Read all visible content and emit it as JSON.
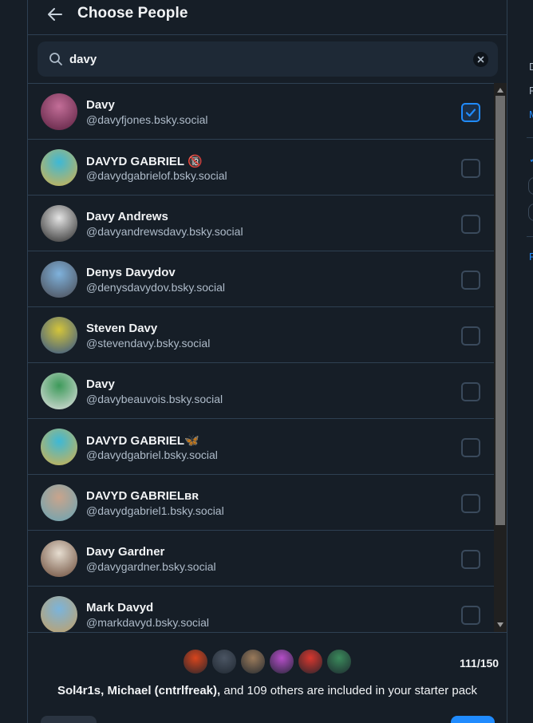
{
  "header": {
    "title": "Choose People"
  },
  "search": {
    "value": "davy"
  },
  "people": [
    {
      "name": "Davy",
      "handle": "@davyfjones.bsky.social",
      "checked": true,
      "avatar_colors": [
        "#c36e98",
        "#5a2040"
      ]
    },
    {
      "name": "DAVYD GABRIEL 🔞",
      "handle": "@davydgabrielof.bsky.social",
      "checked": false,
      "avatar_colors": [
        "#3db8d6",
        "#d6b24a"
      ]
    },
    {
      "name": "Davy Andrews",
      "handle": "@davyandrewsdavy.bsky.social",
      "checked": false,
      "avatar_colors": [
        "#e4e4e4",
        "#2a2a2a"
      ]
    },
    {
      "name": "Denys Davydov",
      "handle": "@denysdavydov.bsky.social",
      "checked": false,
      "avatar_colors": [
        "#7fb2dc",
        "#4a4a52"
      ]
    },
    {
      "name": "Steven Davy",
      "handle": "@stevendavy.bsky.social",
      "checked": false,
      "avatar_colors": [
        "#d4c53a",
        "#33548a"
      ]
    },
    {
      "name": "Davy",
      "handle": "@davybeauvois.bsky.social",
      "checked": false,
      "avatar_colors": [
        "#3d9a5a",
        "#e0e0e0"
      ]
    },
    {
      "name": "DAVYD GABRIEL🦋",
      "handle": "@davydgabriel.bsky.social",
      "checked": false,
      "avatar_colors": [
        "#3db8d6",
        "#d6b24a"
      ]
    },
    {
      "name": "DAVYD GABRIELʙʀ",
      "handle": "@davydgabriel1.bsky.social",
      "checked": false,
      "avatar_colors": [
        "#c9a48c",
        "#68a4b4"
      ]
    },
    {
      "name": "Davy Gardner",
      "handle": "@davygardner.bsky.social",
      "checked": false,
      "avatar_colors": [
        "#e6ddd0",
        "#6a4a38"
      ]
    },
    {
      "name": "Mark Davyd",
      "handle": "@markdavyd.bsky.social",
      "checked": false,
      "avatar_colors": [
        "#7ab4dc",
        "#c4a064"
      ]
    }
  ],
  "footer": {
    "count": "111/150",
    "summary_bold": "Sol4r1s, Michael (cntrlfreak),",
    "summary_rest": " and 109 others are included in your starter pack",
    "stack_colors": [
      "#d8451d",
      "#4b5563",
      "#9b7b5b",
      "#b54ec8",
      "#d8372e",
      "#3b8a5b"
    ]
  },
  "background_fragments": [
    "D",
    "F",
    "M",
    "✓",
    "F"
  ],
  "colors": {
    "accent": "#208bfe",
    "bg": "#161e27",
    "border": "#2e4052",
    "muted": "#aebbc9"
  }
}
